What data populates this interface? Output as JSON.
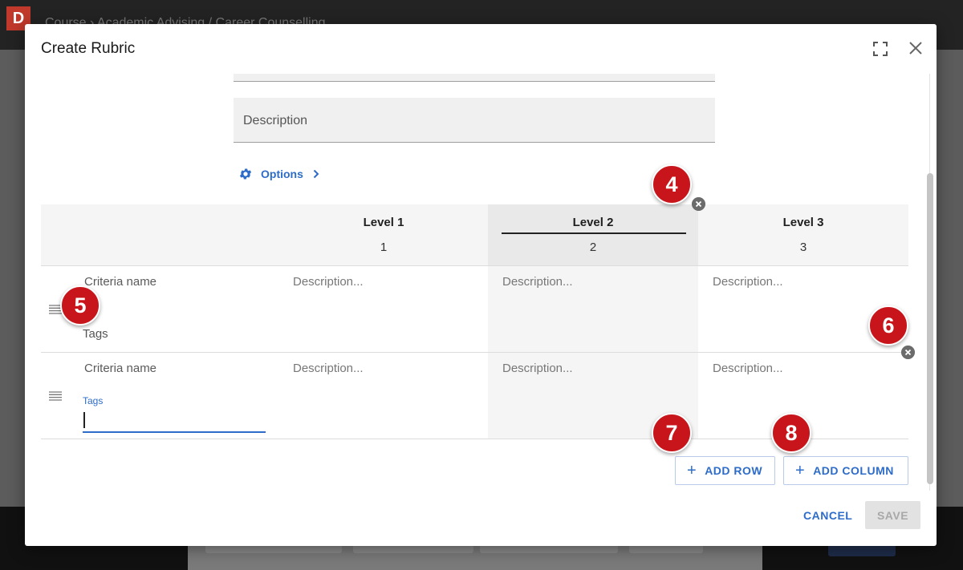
{
  "background": {
    "logo_letter": "D",
    "breadcrumb": "Course  ›  Academic Advising / Career Counselling"
  },
  "modal": {
    "title": "Create Rubric",
    "description_placeholder": "Description",
    "options_label": "Options"
  },
  "rubric": {
    "levels": [
      {
        "name": "Level 1",
        "points": "1"
      },
      {
        "name": "Level 2",
        "points": "2"
      },
      {
        "name": "Level 3",
        "points": "3"
      }
    ],
    "criteria": [
      {
        "name_placeholder": "Criteria name",
        "tags_label": "Tags",
        "cells": [
          "Description...",
          "Description...",
          "Description..."
        ]
      },
      {
        "name_placeholder": "Criteria name",
        "tags_label": "Tags",
        "cells": [
          "Description...",
          "Description...",
          "Description..."
        ]
      }
    ]
  },
  "actions": {
    "add_row": "ADD ROW",
    "add_column": "ADD COLUMN",
    "cancel": "CANCEL",
    "save": "SAVE"
  },
  "callouts": [
    "4",
    "5",
    "6",
    "7",
    "8"
  ],
  "colors": {
    "accent": "#2d6cc9",
    "callout": "#c8151b"
  }
}
